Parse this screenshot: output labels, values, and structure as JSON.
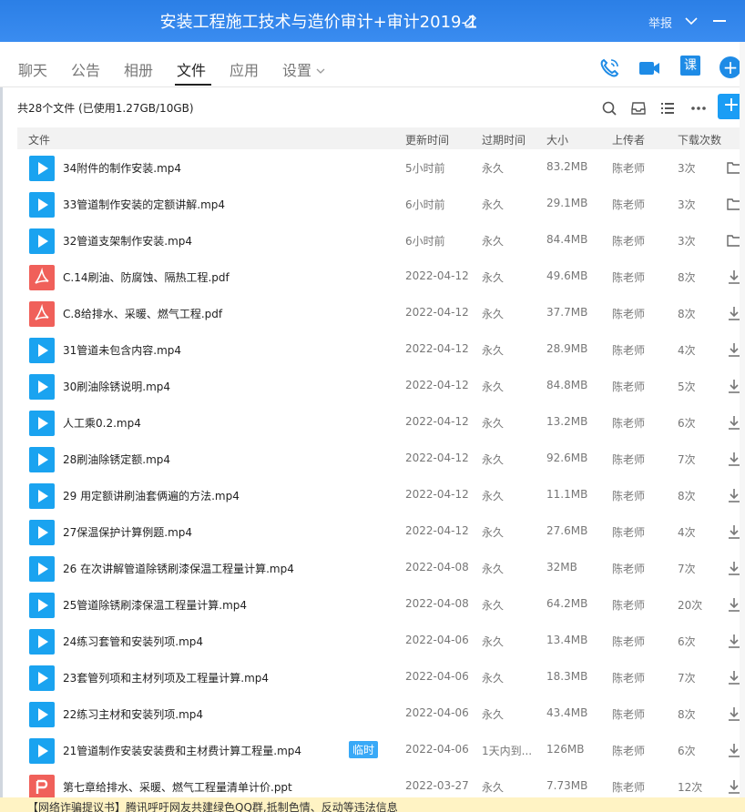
{
  "window": {
    "title": "安装工程施工技术与造价审计+审计2019-1",
    "report_label": "举报"
  },
  "tabs": [
    {
      "label": "聊天"
    },
    {
      "label": "公告"
    },
    {
      "label": "相册"
    },
    {
      "label": "文件"
    },
    {
      "label": "应用"
    },
    {
      "label": "设置"
    }
  ],
  "toolbar": {
    "course_label": "课",
    "add_label": "+"
  },
  "summary": "共28个文件 (已使用1.27GB/10GB)",
  "columns": {
    "name": "文件",
    "updated": "更新时间",
    "expires": "过期时间",
    "size": "大小",
    "uploader": "上传者",
    "downloads": "下载次数"
  },
  "files": [
    {
      "type": "video",
      "name": "34附件的制作安装.mp4",
      "tag": "",
      "updated": "5小时前",
      "expires": "永久",
      "size": "83.2MB",
      "uploader": "陈老师",
      "downloads": "3次",
      "action": "folder-icon"
    },
    {
      "type": "video",
      "name": "33管道制作安装的定额讲解.mp4",
      "tag": "",
      "updated": "6小时前",
      "expires": "永久",
      "size": "29.1MB",
      "uploader": "陈老师",
      "downloads": "3次",
      "action": "folder-icon"
    },
    {
      "type": "video",
      "name": "32管道支架制作安装.mp4",
      "tag": "",
      "updated": "6小时前",
      "expires": "永久",
      "size": "84.4MB",
      "uploader": "陈老师",
      "downloads": "3次",
      "action": "folder-icon"
    },
    {
      "type": "pdf",
      "name": "C.14刷油、防腐蚀、隔热工程.pdf",
      "tag": "",
      "updated": "2022-04-12",
      "expires": "永久",
      "size": "49.6MB",
      "uploader": "陈老师",
      "downloads": "8次",
      "action": "download-icon"
    },
    {
      "type": "pdf",
      "name": "C.8给排水、采暖、燃气工程.pdf",
      "tag": "",
      "updated": "2022-04-12",
      "expires": "永久",
      "size": "37.7MB",
      "uploader": "陈老师",
      "downloads": "8次",
      "action": "download-icon"
    },
    {
      "type": "video",
      "name": "31管道未包含内容.mp4",
      "tag": "",
      "updated": "2022-04-12",
      "expires": "永久",
      "size": "28.9MB",
      "uploader": "陈老师",
      "downloads": "4次",
      "action": "download-icon"
    },
    {
      "type": "video",
      "name": "30刷油除锈说明.mp4",
      "tag": "",
      "updated": "2022-04-12",
      "expires": "永久",
      "size": "84.8MB",
      "uploader": "陈老师",
      "downloads": "5次",
      "action": "download-icon"
    },
    {
      "type": "video",
      "name": "人工乘0.2.mp4",
      "tag": "",
      "updated": "2022-04-12",
      "expires": "永久",
      "size": "13.2MB",
      "uploader": "陈老师",
      "downloads": "6次",
      "action": "download-icon"
    },
    {
      "type": "video",
      "name": "28刷油除锈定额.mp4",
      "tag": "",
      "updated": "2022-04-12",
      "expires": "永久",
      "size": "92.6MB",
      "uploader": "陈老师",
      "downloads": "7次",
      "action": "download-icon"
    },
    {
      "type": "video",
      "name": "29 用定额讲刷油套俩遍的方法.mp4",
      "tag": "",
      "updated": "2022-04-12",
      "expires": "永久",
      "size": "11.1MB",
      "uploader": "陈老师",
      "downloads": "8次",
      "action": "download-icon"
    },
    {
      "type": "video",
      "name": "27保温保护计算例题.mp4",
      "tag": "",
      "updated": "2022-04-12",
      "expires": "永久",
      "size": "27.6MB",
      "uploader": "陈老师",
      "downloads": "4次",
      "action": "download-icon"
    },
    {
      "type": "video",
      "name": "26 在次讲解管道除锈刷漆保温工程量计算.mp4",
      "tag": "",
      "updated": "2022-04-08",
      "expires": "永久",
      "size": "32MB",
      "uploader": "陈老师",
      "downloads": "7次",
      "action": "download-icon"
    },
    {
      "type": "video",
      "name": "25管道除锈刷漆保温工程量计算.mp4",
      "tag": "",
      "updated": "2022-04-08",
      "expires": "永久",
      "size": "64.2MB",
      "uploader": "陈老师",
      "downloads": "20次",
      "action": "download-icon"
    },
    {
      "type": "video",
      "name": "24练习套管和安装列项.mp4",
      "tag": "",
      "updated": "2022-04-06",
      "expires": "永久",
      "size": "13.4MB",
      "uploader": "陈老师",
      "downloads": "6次",
      "action": "download-icon"
    },
    {
      "type": "video",
      "name": "23套管列项和主材列项及工程量计算.mp4",
      "tag": "",
      "updated": "2022-04-06",
      "expires": "永久",
      "size": "18.3MB",
      "uploader": "陈老师",
      "downloads": "7次",
      "action": "download-icon"
    },
    {
      "type": "video",
      "name": "22练习主材和安装列项.mp4",
      "tag": "",
      "updated": "2022-04-06",
      "expires": "永久",
      "size": "43.4MB",
      "uploader": "陈老师",
      "downloads": "8次",
      "action": "download-icon"
    },
    {
      "type": "video",
      "name": "21管道制作安装安装费和主材费计算工程量.mp4",
      "tag": "临时",
      "updated": "2022-04-06",
      "expires": "1天内到...",
      "size": "126MB",
      "uploader": "陈老师",
      "downloads": "6次",
      "action": "download-icon"
    },
    {
      "type": "ppt",
      "name": "第七章给排水、采暖、燃气工程量清单计价.ppt",
      "tag": "",
      "updated": "2022-03-27",
      "expires": "永久",
      "size": "7.73MB",
      "uploader": "陈老师",
      "downloads": "12次",
      "action": "download-icon"
    }
  ],
  "notice": "【网络诈骗提议书】腾讯呼吁网友共建绿色QQ群,抵制色情、反动等违法信息"
}
